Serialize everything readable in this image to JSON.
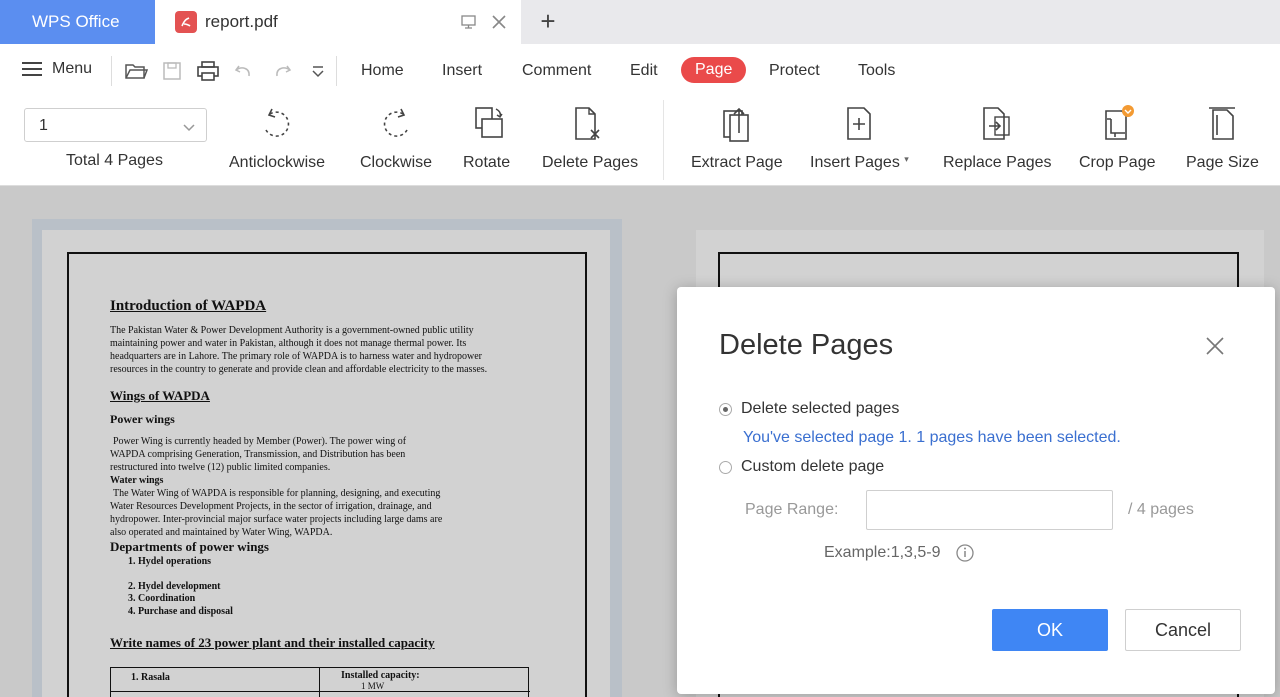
{
  "tabs": {
    "app_label": "WPS Office",
    "document_title": "report.pdf",
    "new_tab": "+"
  },
  "menu": {
    "label": "Menu",
    "tabs": [
      "Home",
      "Insert",
      "Comment",
      "Edit",
      "Page",
      "Protect",
      "Tools"
    ],
    "active_tab": "Page"
  },
  "page_nav": {
    "current_page": "1",
    "total_label": "Total 4 Pages"
  },
  "tools": {
    "anticlockwise": "Anticlockwise",
    "clockwise": "Clockwise",
    "rotate": "Rotate",
    "delete_pages": "Delete Pages",
    "extract_page": "Extract Page",
    "insert_pages": "Insert Pages",
    "replace_pages": "Replace Pages",
    "crop_page": "Crop Page",
    "page_size": "Page Size"
  },
  "document": {
    "heading1": "Introduction of WAPDA",
    "para1": [
      "The Pakistan Water & Power Development Authority is a government-owned public utility",
      "maintaining power and water in Pakistan, although it does not manage thermal power. Its",
      "headquarters are in Lahore. The primary role of WAPDA is to harness water and hydropower",
      "resources in the country to generate and provide clean and affordable electricity to the masses."
    ],
    "heading2": "Wings of WAPDA",
    "power_wings_title": "Power wings",
    "power_wings_para": [
      "Power Wing is currently headed by Member (Power). The power wing of",
      "WAPDA comprising Generation, Transmission, and Distribution has been",
      "restructured into twelve (12) public limited companies."
    ],
    "water_wings_title": "Water wings",
    "water_wings_para": [
      "The Water Wing of WAPDA is responsible for planning, designing, and executing",
      "Water Resources Development Projects, in the sector of irrigation, drainage, and",
      "hydropower. Inter-provincial major surface water projects including large dams are",
      "also operated and maintained by Water Wing, WAPDA."
    ],
    "departments_title": "Departments of power wings",
    "departments": [
      "1.   Hydel operations",
      "2.   Hydel development",
      "3.   Coordination",
      "4.   Purchase and disposal"
    ],
    "heading3": "Write names of 23 power plant and their installed capacity",
    "table_col1": "1.    Rasala",
    "table_col2": "Installed capacity:",
    "table_col2_sub": "1 MW"
  },
  "dialog": {
    "title": "Delete Pages",
    "option_selected": "Delete selected pages",
    "selected_note": "You've selected page 1. 1 pages have been selected.",
    "option_custom": "Custom delete page",
    "range_label": "Page Range:",
    "range_value": "",
    "range_total": "/ 4 pages",
    "example": "Example:1,3,5-9",
    "ok": "OK",
    "cancel": "Cancel"
  },
  "colors": {
    "wps_tab": "#5b8ef0",
    "active_menu": "#ea4a4a",
    "ok_button": "#3f86f4",
    "note_text": "#3a6fd0"
  }
}
